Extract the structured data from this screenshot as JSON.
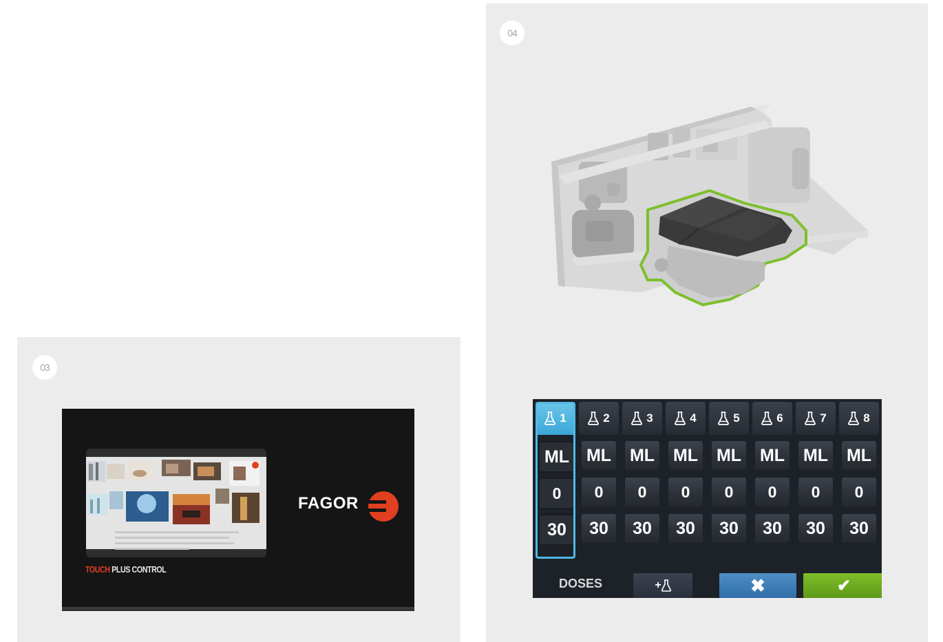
{
  "panel_03": {
    "step_number": "03",
    "screen": {
      "brand": "FAGOR",
      "subtitle_part1": "TOUCH",
      "subtitle_part2": " PLUS CONTROL",
      "brand_color": "#e0401f"
    }
  },
  "panel_04": {
    "step_number": "04",
    "machine_illustration": "dishwasher-detergent-module",
    "highlight_color": "#7dc02c",
    "doses_ui": {
      "columns": [
        {
          "number": "1",
          "unit": "ML",
          "value_a": "0",
          "value_b": "30",
          "selected": true
        },
        {
          "number": "2",
          "unit": "ML",
          "value_a": "0",
          "value_b": "30",
          "selected": false
        },
        {
          "number": "3",
          "unit": "ML",
          "value_a": "0",
          "value_b": "30",
          "selected": false
        },
        {
          "number": "4",
          "unit": "ML",
          "value_a": "0",
          "value_b": "30",
          "selected": false
        },
        {
          "number": "5",
          "unit": "ML",
          "value_a": "0",
          "value_b": "30",
          "selected": false
        },
        {
          "number": "6",
          "unit": "ML",
          "value_a": "0",
          "value_b": "30",
          "selected": false
        },
        {
          "number": "7",
          "unit": "ML",
          "value_a": "0",
          "value_b": "30",
          "selected": false
        },
        {
          "number": "8",
          "unit": "ML",
          "value_a": "0",
          "value_b": "30",
          "selected": false
        }
      ],
      "doses_label": "DOSES",
      "add_icon": "add-flask-icon",
      "add_label": "+",
      "cancel_icon": "✖",
      "confirm_icon": "✔",
      "selected_color": "#52b9e3",
      "cancel_color": "#3f7fb8",
      "confirm_color": "#6fad20"
    }
  }
}
